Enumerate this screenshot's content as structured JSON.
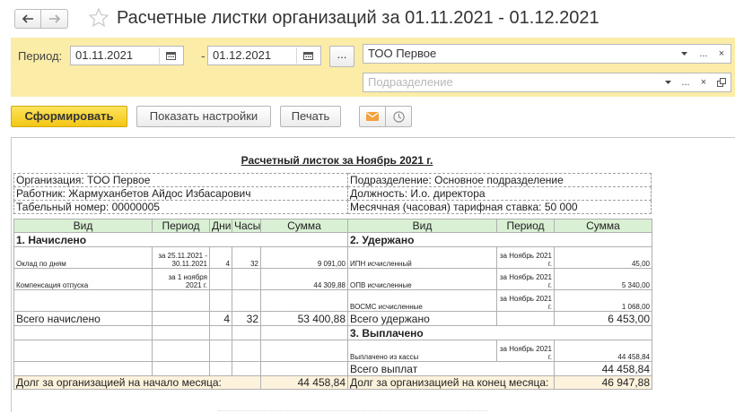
{
  "window": {
    "title": "Расчетные листки организаций  за 01.11.2021 - 01.12.2021"
  },
  "filter": {
    "period_label": "Период:",
    "date_from": "01.11.2021",
    "date_separator": "-",
    "date_to": "01.12.2021",
    "period_button": "...",
    "organization_value": "ТОО Первое",
    "department_placeholder": "Подразделение",
    "select_button": "...",
    "clear_button": "×"
  },
  "toolbar": {
    "generate_label": "Сформировать",
    "settings_label": "Показать настройки",
    "print_label": "Печать"
  },
  "report": {
    "title": "Расчетный листок за Ноябрь 2021 г.",
    "info": {
      "organization": "Организация: ТОО Первое",
      "department": "Подразделение: Основное подразделение",
      "employee": "Работник: Жармуханбетов Айдос Избасарович",
      "position": "Должность: И.о. директора",
      "tab_number": "Табельный номер: 00000005",
      "rate": "Месячная (часовая) тарифная ставка: 50 000"
    },
    "headers": {
      "vid": "Вид",
      "period": "Период",
      "days": "Дни",
      "hours": "Часы",
      "sum": "Сумма",
      "vid2": "Вид",
      "period2": "Период",
      "sum2": "Сумма"
    },
    "sections": {
      "accrued": "1. Начислено",
      "withheld": "2. Удержано",
      "paid": "3. Выплачено"
    },
    "accrued": [
      {
        "name": "Оклад по дням",
        "period": "за 25.11.2021 - 30.11.2021",
        "days": "4",
        "hours": "32",
        "sum": "9 091,00"
      },
      {
        "name": "Компенсация отпуска",
        "period": "за 1 ноября 2021 г.",
        "days": "",
        "hours": "",
        "sum": "44 309,88"
      }
    ],
    "withheld": [
      {
        "name": "ИПН исчисленный",
        "period": "за Ноябрь 2021 г.",
        "sum": "45,00"
      },
      {
        "name": "ОПВ исчисленные",
        "period": "за Ноябрь 2021 г.",
        "sum": "5 340,00"
      },
      {
        "name": "ВОСМС исчисленные",
        "period": "за Ноябрь 2021 г.",
        "sum": "1 068,00"
      }
    ],
    "totals": {
      "accrued_label": "Всего начислено",
      "accrued_days": "4",
      "accrued_hours": "32",
      "accrued_sum": "53 400,88",
      "withheld_label": "Всего удержано",
      "withheld_sum": "6 453,00"
    },
    "paid": [
      {
        "name": "Выплачено из кассы",
        "period": "за Ноябрь 2021 г.",
        "sum": "44 458,84"
      }
    ],
    "paid_total": {
      "label": "Всего выплат",
      "sum": "44 458,84"
    },
    "debt": {
      "start_label": "Долг за организацией на начало месяца:",
      "start_sum": "44 458,84",
      "end_label": "Долг за организацией на конец месяца:",
      "end_sum": "46 947,88"
    }
  },
  "colors": {
    "filter_bg": "#fbeca8",
    "primary_button": "#f3c615",
    "header_green": "#d9f0d4",
    "debt_row": "#fdf3dc"
  },
  "icons": [
    "arrow-left-icon",
    "arrow-right-icon",
    "star-icon",
    "calendar-icon",
    "dropdown-arrow-icon",
    "copy-icon",
    "mail-icon",
    "clock-icon"
  ]
}
